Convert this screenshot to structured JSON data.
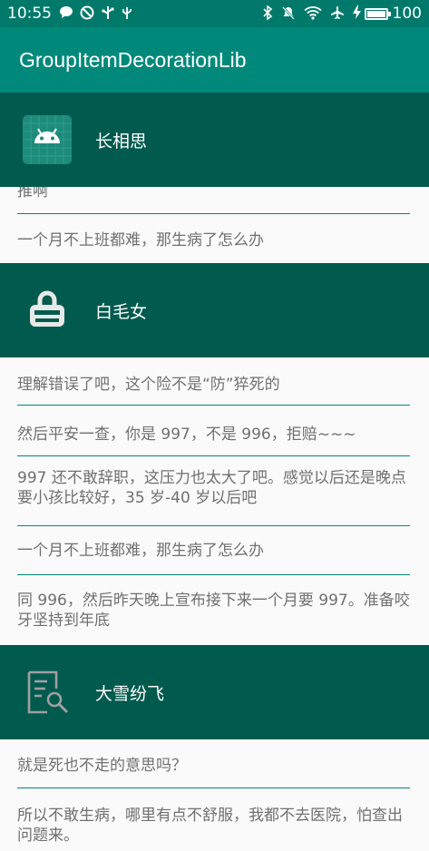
{
  "status_bar": {
    "time": "10:55",
    "battery_text": "100",
    "battery_level": 1.0,
    "left_icons": [
      "chat-icon",
      "do-not-disturb-icon",
      "usb-icon",
      "usb-debug-icon"
    ],
    "right_icons": [
      "bluetooth-icon",
      "notifications-off-icon",
      "wifi-icon",
      "airplane-icon",
      "charging-icon",
      "battery-icon"
    ]
  },
  "app_bar": {
    "title": "GroupItemDecorationLib"
  },
  "groups": [
    {
      "title": "长相思",
      "avatar_icon": "android-icon",
      "items": [
        "推啊",
        "一个月不上班都难，那生病了怎么办"
      ]
    },
    {
      "title": "白毛女",
      "avatar_icon": "basket-icon",
      "items": [
        "理解错误了吧，这个险不是“防”猝死的",
        "然后平安一查，你是 997，不是 996，拒赔~~~",
        "997 还不敢辞职，这压力也太大了吧。感觉以后还是晚点要小孩比较好，35 岁-40 岁以后吧",
        "一个月不上班都难，那生病了怎么办",
        "同 996，然后昨天晚上宣布接下来一个月要 997。准备咬牙坚持到年底"
      ]
    },
    {
      "title": "大雪纷飞",
      "avatar_icon": "document-search-icon",
      "items": [
        "就是死也不走的意思吗？",
        "所以不敢生病，哪里有点不舒服，我都不去医院，怕查出问题来。"
      ]
    }
  ],
  "colors": {
    "status_bar": "#00796b",
    "app_bar": "#00897b",
    "group_header": "#005a4d",
    "divider": "#00897b",
    "item_text": "#707070",
    "list_background": "#fafafa"
  }
}
